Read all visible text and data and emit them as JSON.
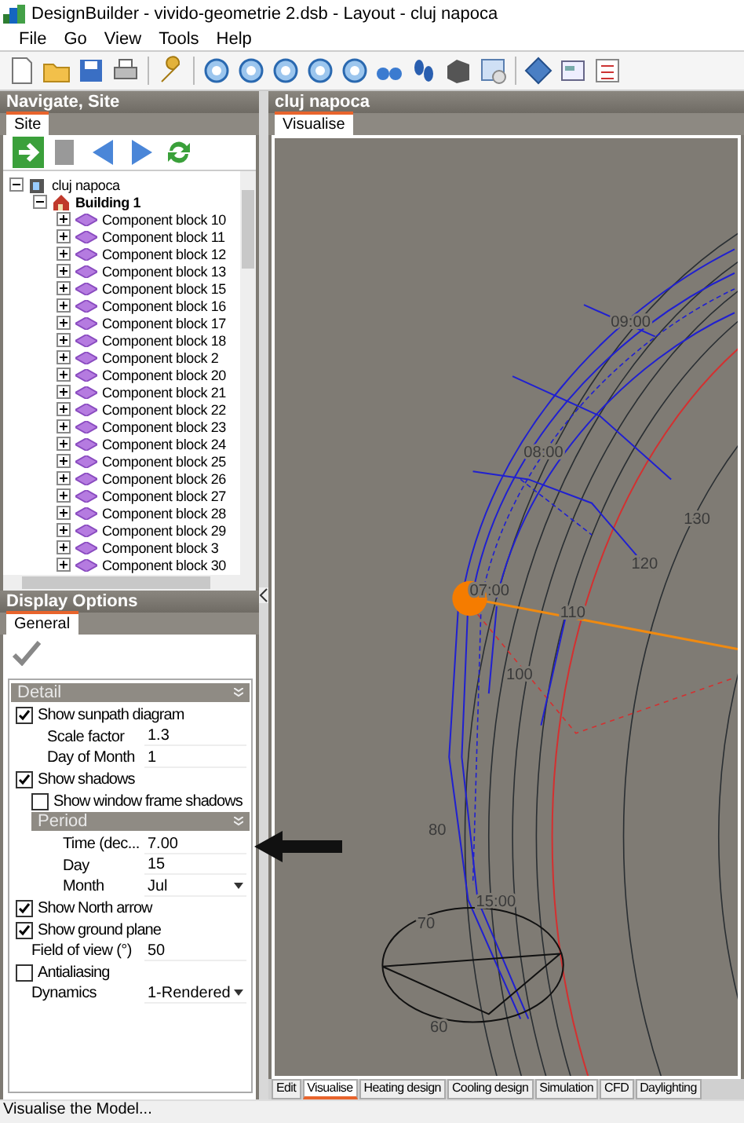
{
  "window": {
    "title": "DesignBuilder - vivido-geometrie 2.dsb - Layout - cluj napoca"
  },
  "menu": [
    "File",
    "Go",
    "View",
    "Tools",
    "Help"
  ],
  "navigate": {
    "title": "Navigate, Site",
    "tabs": [
      {
        "label": "Site",
        "selected": true
      }
    ],
    "tree": [
      {
        "label": "cluj napoca",
        "kind": "site",
        "expanded": true,
        "children": [
          {
            "label": "Building 1",
            "kind": "building",
            "expanded": true,
            "children": [
              {
                "label": "Component block 10",
                "kind": "block",
                "expanded": false
              },
              {
                "label": "Component block 11",
                "kind": "block",
                "expanded": false
              },
              {
                "label": "Component block 12",
                "kind": "block",
                "expanded": false
              },
              {
                "label": "Component block 13",
                "kind": "block",
                "expanded": false
              },
              {
                "label": "Component block 15",
                "kind": "block",
                "expanded": false
              },
              {
                "label": "Component block 16",
                "kind": "block",
                "expanded": false
              },
              {
                "label": "Component block 17",
                "kind": "block",
                "expanded": false
              },
              {
                "label": "Component block 18",
                "kind": "block",
                "expanded": false
              },
              {
                "label": "Component block 2",
                "kind": "block",
                "expanded": false
              },
              {
                "label": "Component block 20",
                "kind": "block",
                "expanded": false
              },
              {
                "label": "Component block 21",
                "kind": "block",
                "expanded": false
              },
              {
                "label": "Component block 22",
                "kind": "block",
                "expanded": false
              },
              {
                "label": "Component block 23",
                "kind": "block",
                "expanded": false
              },
              {
                "label": "Component block 24",
                "kind": "block",
                "expanded": false
              },
              {
                "label": "Component block 25",
                "kind": "block",
                "expanded": false
              },
              {
                "label": "Component block 26",
                "kind": "block",
                "expanded": false
              },
              {
                "label": "Component block 27",
                "kind": "block",
                "expanded": false
              },
              {
                "label": "Component block 28",
                "kind": "block",
                "expanded": false
              },
              {
                "label": "Component block 29",
                "kind": "block",
                "expanded": false
              },
              {
                "label": "Component block 3",
                "kind": "block",
                "expanded": false
              },
              {
                "label": "Component block 30",
                "kind": "block",
                "expanded": false
              }
            ]
          }
        ]
      }
    ]
  },
  "display_options": {
    "title": "Display Options",
    "tabs": [
      {
        "label": "General",
        "selected": true
      }
    ],
    "section": {
      "title": "Detail",
      "items": [
        {
          "kind": "check",
          "label": "Show sunpath diagram",
          "checked": true,
          "children": [
            {
              "kind": "field",
              "label": "Scale factor",
              "value": "1.3"
            },
            {
              "kind": "field",
              "label": "Day of Month",
              "value": "1"
            }
          ]
        },
        {
          "kind": "check",
          "label": "Show shadows",
          "checked": true,
          "children": [
            {
              "kind": "check",
              "label": "Show window frame shadows",
              "checked": false
            },
            {
              "kind": "group",
              "label": "Period",
              "children": [
                {
                  "kind": "field",
                  "label": "Time (dec...",
                  "value": "7.00"
                },
                {
                  "kind": "field",
                  "label": "Day",
                  "value": "15"
                },
                {
                  "kind": "select",
                  "label": "Month",
                  "value": "Jul"
                }
              ]
            }
          ]
        },
        {
          "kind": "check",
          "label": "Show North arrow",
          "checked": true
        },
        {
          "kind": "check",
          "label": "Show ground plane",
          "checked": true
        },
        {
          "kind": "field",
          "label": "Field of view (°)",
          "value": "50"
        },
        {
          "kind": "check",
          "label": "Antialiasing",
          "checked": false
        },
        {
          "kind": "select",
          "label": "Dynamics",
          "value": "1-Rendered"
        }
      ]
    }
  },
  "view": {
    "title": "cluj napoca",
    "tabs": [
      {
        "label": "Visualise",
        "selected": true
      }
    ],
    "labels": [
      "09:00",
      "08:00",
      "130",
      "120",
      "07:00",
      "110",
      "100",
      "80",
      "15:00",
      "70",
      "60"
    ]
  },
  "bottom_tabs": [
    {
      "label": "Edit",
      "selected": false
    },
    {
      "label": "Visualise",
      "selected": true
    },
    {
      "label": "Heating design",
      "selected": false
    },
    {
      "label": "Cooling design",
      "selected": false
    },
    {
      "label": "Simulation",
      "selected": false
    },
    {
      "label": "CFD",
      "selected": false
    },
    {
      "label": "Daylighting",
      "selected": false
    }
  ],
  "status_bar": "Visualise the Model..."
}
